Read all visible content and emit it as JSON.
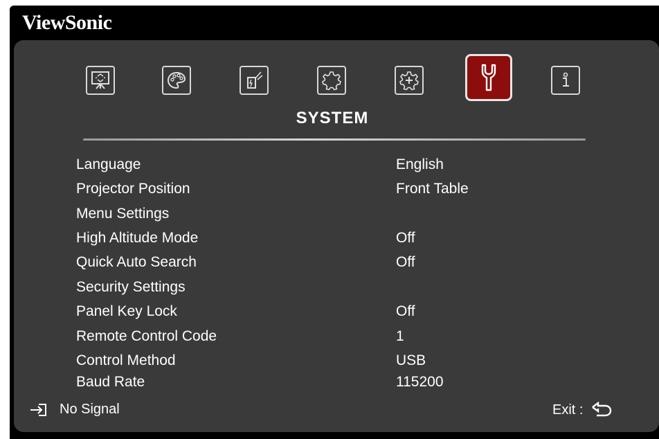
{
  "brand": "ViewSonic",
  "tabs": [
    {
      "icon": "display-icon",
      "active": false
    },
    {
      "icon": "palette-icon",
      "active": false
    },
    {
      "icon": "power-icon",
      "active": false
    },
    {
      "icon": "gear-icon",
      "active": false
    },
    {
      "icon": "advanced-gear-icon",
      "active": false
    },
    {
      "icon": "wrench-icon",
      "active": true
    },
    {
      "icon": "info-icon",
      "active": false
    }
  ],
  "section_title": "SYSTEM",
  "menu": [
    {
      "label": "Language",
      "value": "English"
    },
    {
      "label": "Projector Position",
      "value": "Front Table"
    },
    {
      "label": "Menu Settings",
      "value": ""
    },
    {
      "label": "High Altitude Mode",
      "value": "Off"
    },
    {
      "label": "Quick Auto Search",
      "value": "Off"
    },
    {
      "label": "Security Settings",
      "value": ""
    },
    {
      "label": "Panel Key Lock",
      "value": "Off"
    },
    {
      "label": "Remote Control Code",
      "value": "1"
    },
    {
      "label": "Control Method",
      "value": "USB"
    },
    {
      "label": "Baud Rate",
      "value": "115200"
    }
  ],
  "footer": {
    "input_status": "No Signal",
    "exit_label": "Exit :"
  },
  "colors": {
    "panel": "#3a3a3a",
    "active_tab": "#8d0c0c",
    "text": "#ffffff"
  }
}
